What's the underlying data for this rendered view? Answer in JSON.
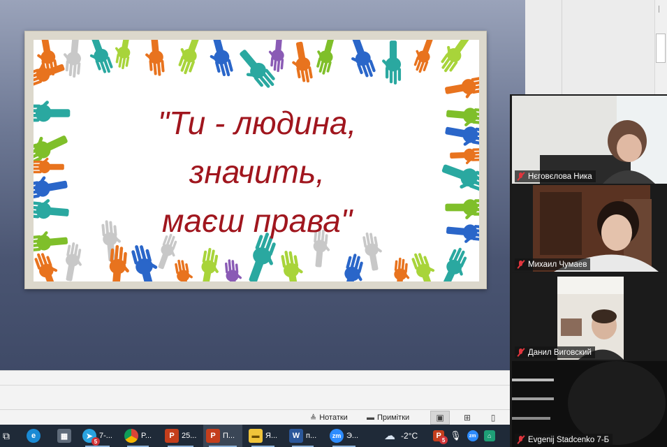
{
  "slide": {
    "lines": [
      "\"Ти - людина,",
      "значить,",
      "маєш права\""
    ],
    "text_color": "#a0161e"
  },
  "statusbar": {
    "notes_label": "Нотатки",
    "comments_label": "Примітки"
  },
  "participants": [
    {
      "name": "Нєговєлова Ника",
      "muted": true
    },
    {
      "name": "Михаил Чумаев",
      "muted": true
    },
    {
      "name": "Данил Виговский",
      "muted": true
    },
    {
      "name": "Evgenij Stadcenko 7-Б",
      "muted": true
    }
  ],
  "taskbar": {
    "telegram_label": "7-...",
    "telegram_badge": "5",
    "chrome_label": "P...",
    "ppt1_label": "25...",
    "ppt2_label": "П...",
    "explorer_label": "Я...",
    "word_label": "п...",
    "zoom_label": "Э...",
    "temperature": "-2°C",
    "tray_badge": "5"
  },
  "colors": {
    "taskbar_bg": "#1f2a38",
    "hand_palette": [
      "#2aa8a0",
      "#e8731e",
      "#2a66c9",
      "#7fbf2a",
      "#a8d43a",
      "#8a5bb5",
      "#c8c8c8"
    ]
  }
}
